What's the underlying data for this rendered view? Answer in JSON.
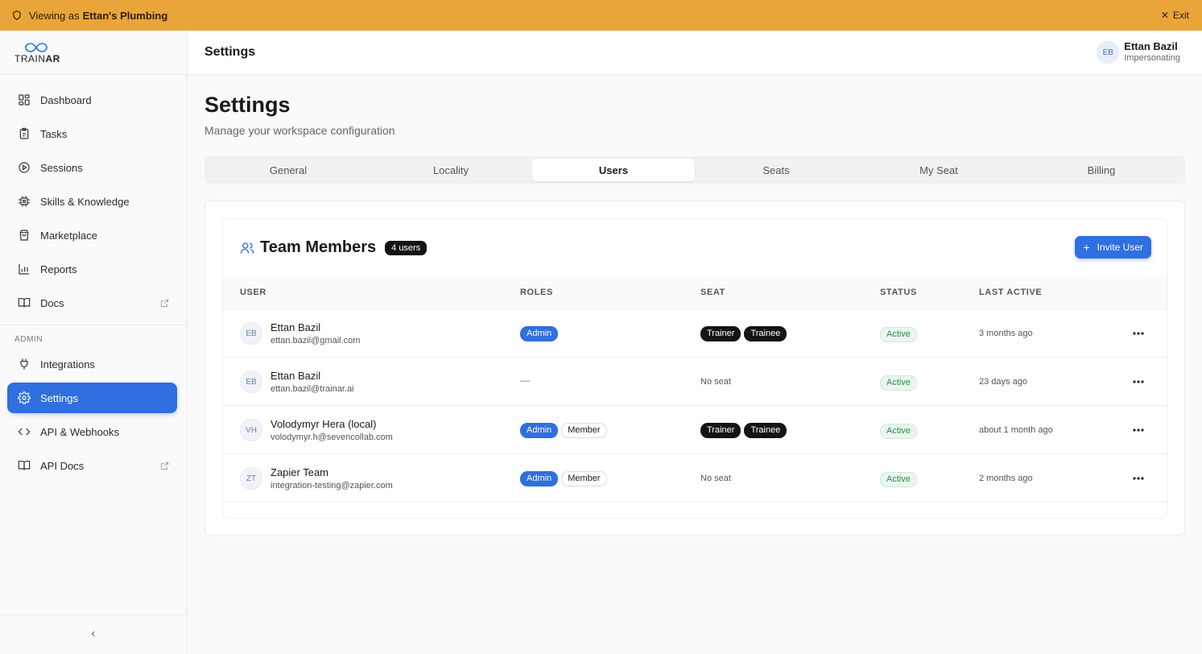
{
  "banner": {
    "prefix": "Viewing as",
    "org": "Ettan's Plumbing",
    "exit_label": "Exit",
    "color": "#e9a53a"
  },
  "brand": {
    "logo_text_a": "TRAIN",
    "logo_text_b": "AR"
  },
  "sidebar": {
    "items": [
      {
        "label": "Dashboard",
        "icon": "dashboard-icon"
      },
      {
        "label": "Tasks",
        "icon": "clipboard-icon"
      },
      {
        "label": "Sessions",
        "icon": "play-circle-icon"
      },
      {
        "label": "Skills & Knowledge",
        "icon": "chip-icon"
      },
      {
        "label": "Marketplace",
        "icon": "shopping-bag-icon"
      },
      {
        "label": "Reports",
        "icon": "bar-chart-icon"
      },
      {
        "label": "Docs",
        "icon": "book-icon",
        "external": true
      }
    ],
    "admin_label": "ADMIN",
    "admin_items": [
      {
        "label": "Integrations",
        "icon": "plug-icon"
      },
      {
        "label": "Settings",
        "icon": "gear-icon",
        "active": true
      },
      {
        "label": "API & Webhooks",
        "icon": "code-icon"
      },
      {
        "label": "API Docs",
        "icon": "book-icon",
        "external": true
      }
    ]
  },
  "topbar": {
    "title": "Settings",
    "user": {
      "initials": "EB",
      "name": "Ettan Bazil",
      "status": "Impersonating"
    }
  },
  "page": {
    "title": "Settings",
    "subtitle": "Manage your workspace configuration",
    "tabs": [
      {
        "label": "General"
      },
      {
        "label": "Locality"
      },
      {
        "label": "Users",
        "active": true
      },
      {
        "label": "Seats"
      },
      {
        "label": "My Seat"
      },
      {
        "label": "Billing"
      }
    ]
  },
  "team": {
    "title": "Team Members",
    "count": "4 users",
    "invite_label": "Invite User",
    "columns": {
      "user": "USER",
      "roles": "ROLES",
      "seat": "SEAT",
      "status": "STATUS",
      "last_active": "LAST ACTIVE"
    },
    "rows": [
      {
        "initials": "EB",
        "name": "Ettan Bazil",
        "email": "ettan.bazil@gmail.com",
        "roles": [
          "Admin"
        ],
        "seats": [
          "Trainer",
          "Trainee"
        ],
        "status": "Active",
        "last_active": "3 months ago"
      },
      {
        "initials": "EB",
        "name": "Ettan Bazil",
        "email": "ettan.bazil@trainar.ai",
        "roles_text": "—",
        "seat_text": "No seat",
        "status": "Active",
        "last_active": "23 days ago"
      },
      {
        "initials": "VH",
        "name": "Volodymyr Hera (local)",
        "email": "volodymyr.h@sevencollab.com",
        "roles": [
          "Admin",
          "Member"
        ],
        "seats": [
          "Trainer",
          "Trainee"
        ],
        "status": "Active",
        "last_active": "about 1 month ago"
      },
      {
        "initials": "ZT",
        "name": "Zapier Team",
        "email": "integration-testing@zapier.com",
        "roles": [
          "Admin",
          "Member"
        ],
        "seat_text": "No seat",
        "status": "Active",
        "last_active": "2 months ago"
      }
    ]
  }
}
